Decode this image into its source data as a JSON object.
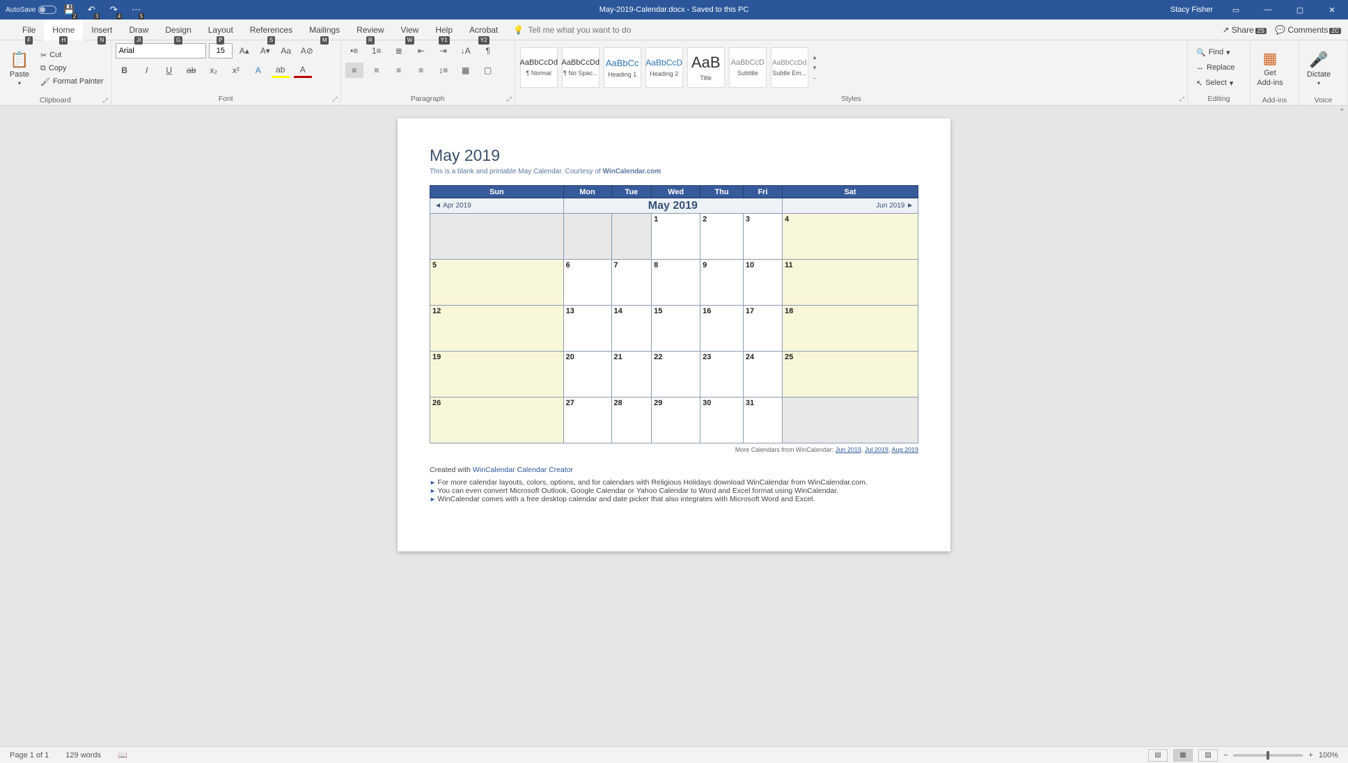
{
  "titlebar": {
    "autosave": "AutoSave",
    "doc_title": "May-2019-Calendar.docx  -  Saved to this PC",
    "user": "Stacy Fisher",
    "qat_badges": [
      "2",
      "3",
      "4",
      "5"
    ]
  },
  "tabs": {
    "file": "File",
    "home": "Home",
    "insert": "Insert",
    "draw": "Draw",
    "design": "Design",
    "layout": "Layout",
    "references": "References",
    "mailings": "Mailings",
    "review": "Review",
    "view": "View",
    "help": "Help",
    "acrobat": "Acrobat",
    "keys": {
      "file": "F",
      "home": "H",
      "insert": "N",
      "draw": "JI",
      "design": "G",
      "layout": "P",
      "references": "S",
      "mailings": "M",
      "review": "R",
      "view": "W",
      "help": "Y1",
      "acrobat": "Y2"
    },
    "tellme": "Tell me what you want to do",
    "share": "Share",
    "share_key": "ZS",
    "comments": "Comments",
    "comments_key": "ZC"
  },
  "clipboard": {
    "group": "Clipboard",
    "paste": "Paste",
    "cut": "Cut",
    "copy": "Copy",
    "format_painter": "Format Painter"
  },
  "font": {
    "group": "Font",
    "name": "Arial",
    "size": "15"
  },
  "paragraph": {
    "group": "Paragraph"
  },
  "styles": {
    "group": "Styles",
    "items": [
      {
        "preview": "AaBbCcDd",
        "name": "¶ Normal"
      },
      {
        "preview": "AaBbCcDd",
        "name": "¶ No Spac..."
      },
      {
        "preview": "AaBbCc",
        "name": "Heading 1"
      },
      {
        "preview": "AaBbCcD",
        "name": "Heading 2"
      },
      {
        "preview": "AaB",
        "name": "Title"
      },
      {
        "preview": "AaBbCcD",
        "name": "Subtitle"
      },
      {
        "preview": "AaBbCcDd",
        "name": "Subtle Em..."
      }
    ]
  },
  "editing": {
    "group": "Editing",
    "find": "Find",
    "replace": "Replace",
    "select": "Select"
  },
  "addins": {
    "group": "Add-ins",
    "get": "Get",
    "sub": "Add-ins"
  },
  "voice": {
    "group": "Voice",
    "dictate": "Dictate"
  },
  "document": {
    "title": "May 2019",
    "subtitle_pre": "This is a blank and printable May Calendar.  Courtesy of ",
    "subtitle_link": "WinCalendar.com",
    "prev_month": "◄ Apr 2019",
    "header_month": "May   2019",
    "next_month": "Jun 2019 ►",
    "days": [
      "Sun",
      "Mon",
      "Tue",
      "Wed",
      "Thu",
      "Fri",
      "Sat"
    ],
    "weeks": [
      [
        {
          "n": "",
          "off": true
        },
        {
          "n": "",
          "off": true
        },
        {
          "n": "",
          "off": true
        },
        {
          "n": "1"
        },
        {
          "n": "2"
        },
        {
          "n": "3"
        },
        {
          "n": "4",
          "w": true
        }
      ],
      [
        {
          "n": "5",
          "w": true
        },
        {
          "n": "6"
        },
        {
          "n": "7"
        },
        {
          "n": "8"
        },
        {
          "n": "9"
        },
        {
          "n": "10"
        },
        {
          "n": "11",
          "w": true
        }
      ],
      [
        {
          "n": "12",
          "w": true
        },
        {
          "n": "13"
        },
        {
          "n": "14"
        },
        {
          "n": "15"
        },
        {
          "n": "16"
        },
        {
          "n": "17"
        },
        {
          "n": "18",
          "w": true
        }
      ],
      [
        {
          "n": "19",
          "w": true
        },
        {
          "n": "20"
        },
        {
          "n": "21"
        },
        {
          "n": "22"
        },
        {
          "n": "23"
        },
        {
          "n": "24"
        },
        {
          "n": "25",
          "w": true
        }
      ],
      [
        {
          "n": "26",
          "w": true
        },
        {
          "n": "27"
        },
        {
          "n": "28"
        },
        {
          "n": "29"
        },
        {
          "n": "30"
        },
        {
          "n": "31"
        },
        {
          "n": "",
          "off": true
        }
      ]
    ],
    "more_pre": "More Calendars from WinCalendar: ",
    "more_links": [
      "Jun 2019",
      "Jul 2019",
      "Aug 2019"
    ],
    "created_pre": "Created with ",
    "created_link": "WinCalendar Calendar Creator",
    "bullets": [
      "For more calendar layouts, colors, options, and for calendars with Religious Holidays download WinCalendar from WinCalendar.com.",
      "You can even convert Microsoft Outlook, Google Calendar or Yahoo Calendar to Word and Excel format using WinCalendar.",
      "WinCalendar comes with a free desktop calendar and date picker that also integrates with Microsoft Word and Excel."
    ]
  },
  "status": {
    "page": "Page 1 of 1",
    "words": "129 words",
    "zoom": "100%"
  }
}
